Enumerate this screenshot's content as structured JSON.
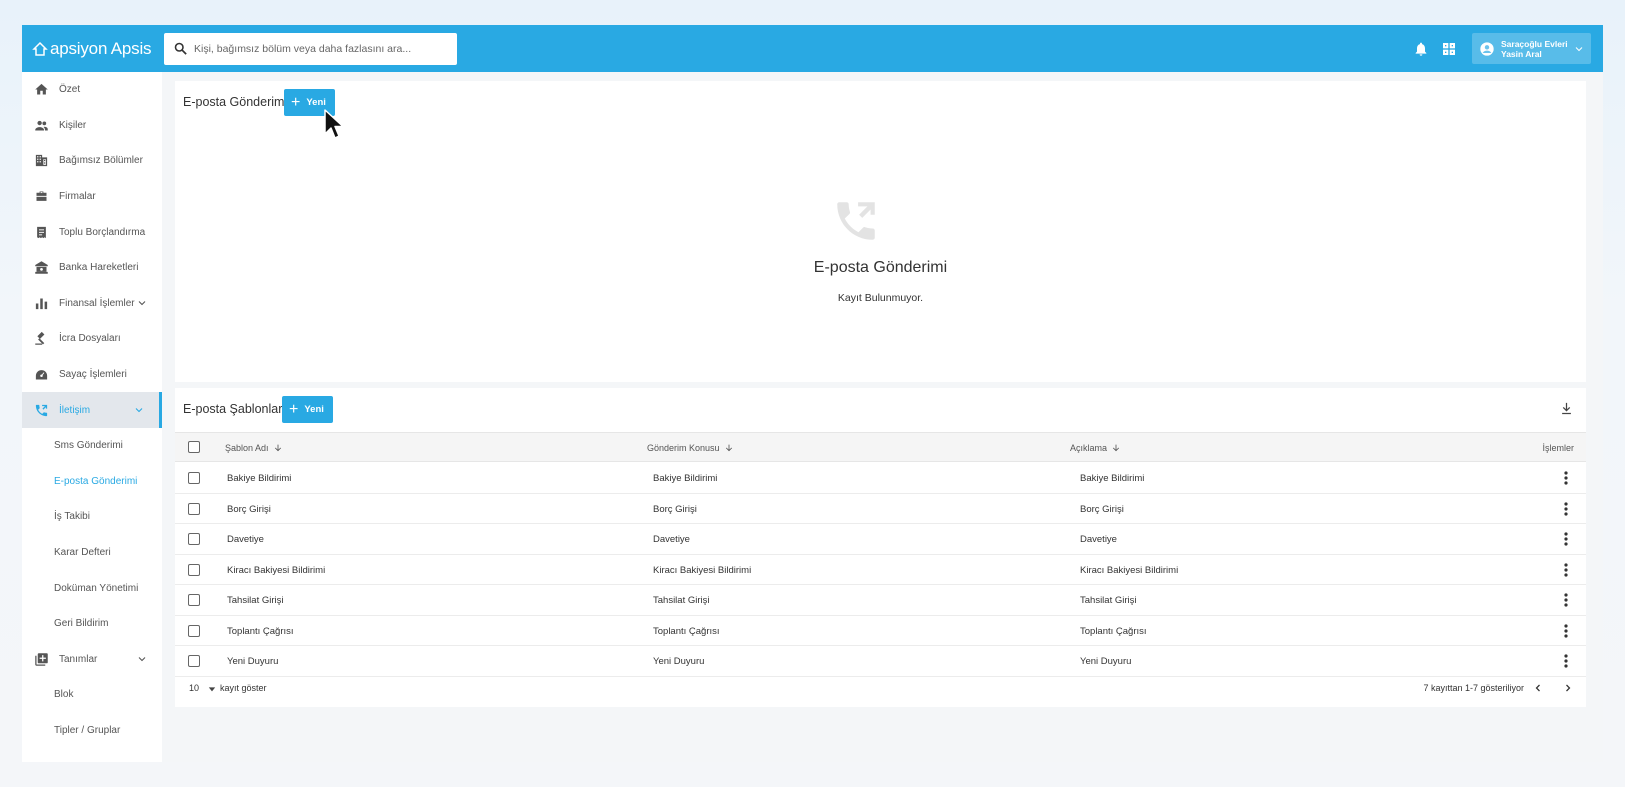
{
  "topbar": {
    "logo": "apsiyon Apsis",
    "search_placeholder": "Kişi, bağımsız bölüm veya daha fazlasını ara...",
    "user_line1": "Saraçoğlu Evleri",
    "user_line2": "Yasin Aral"
  },
  "sidebar": {
    "items": [
      {
        "label": "Özet",
        "icon": "home-icon"
      },
      {
        "label": "Kişiler",
        "icon": "people-icon"
      },
      {
        "label": "Bağımsız Bölümler",
        "icon": "building-icon"
      },
      {
        "label": "Firmalar",
        "icon": "briefcase-icon"
      },
      {
        "label": "Toplu Borçlandırma",
        "icon": "receipt-icon"
      },
      {
        "label": "Banka Hareketleri",
        "icon": "bank-icon"
      },
      {
        "label": "Finansal İşlemler",
        "icon": "bar-chart-icon"
      },
      {
        "label": "İcra Dosyaları",
        "icon": "gavel-icon"
      },
      {
        "label": "Sayaç İşlemleri",
        "icon": "meter-icon"
      },
      {
        "label": "İletişim",
        "icon": "phone-forward-icon"
      }
    ],
    "sub_items": [
      "Sms Gönderimi",
      "E-posta Gönderimi",
      "İş Takibi",
      "Karar Defteri",
      "Doküman Yönetimi",
      "Geri Bildirim"
    ],
    "tanimlar": {
      "label": "Tanımlar",
      "icon": "library-add-icon"
    },
    "tanimlar_sub": [
      "Blok",
      "Tipler / Gruplar"
    ]
  },
  "email_section": {
    "title": "E-posta Gönderimi",
    "new_button": "Yeni",
    "empty_title": "E-posta Gönderimi",
    "empty_text": "Kayıt Bulunmuyor."
  },
  "templates_section": {
    "title": "E-posta Şablonları",
    "new_button": "Yeni",
    "columns": [
      "Şablon Adı",
      "Gönderim Konusu",
      "Açıklama",
      "İşlemler"
    ],
    "rows": [
      [
        "Bakiye Bildirimi",
        "Bakiye Bildirimi",
        "Bakiye Bildirimi"
      ],
      [
        "Borç Girişi",
        "Borç Girişi",
        "Borç Girişi"
      ],
      [
        "Davetiye",
        "Davetiye",
        "Davetiye"
      ],
      [
        "Kiracı Bakiyesi Bildirimi",
        "Kiracı Bakiyesi Bildirimi",
        "Kiracı Bakiyesi Bildirimi"
      ],
      [
        "Tahsilat Girişi",
        "Tahsilat Girişi",
        "Tahsilat Girişi"
      ],
      [
        "Toplantı Çağrısı",
        "Toplantı Çağrısı",
        "Toplantı Çağrısı"
      ],
      [
        "Yeni Duyuru",
        "Yeni Duyuru",
        "Yeni Duyuru"
      ]
    ],
    "page_size": "10",
    "page_size_label": "kayıt göster",
    "page_info": "7 kayıttan 1-7 gösteriliyor"
  },
  "colors": {
    "accent": "#29a9e3"
  }
}
